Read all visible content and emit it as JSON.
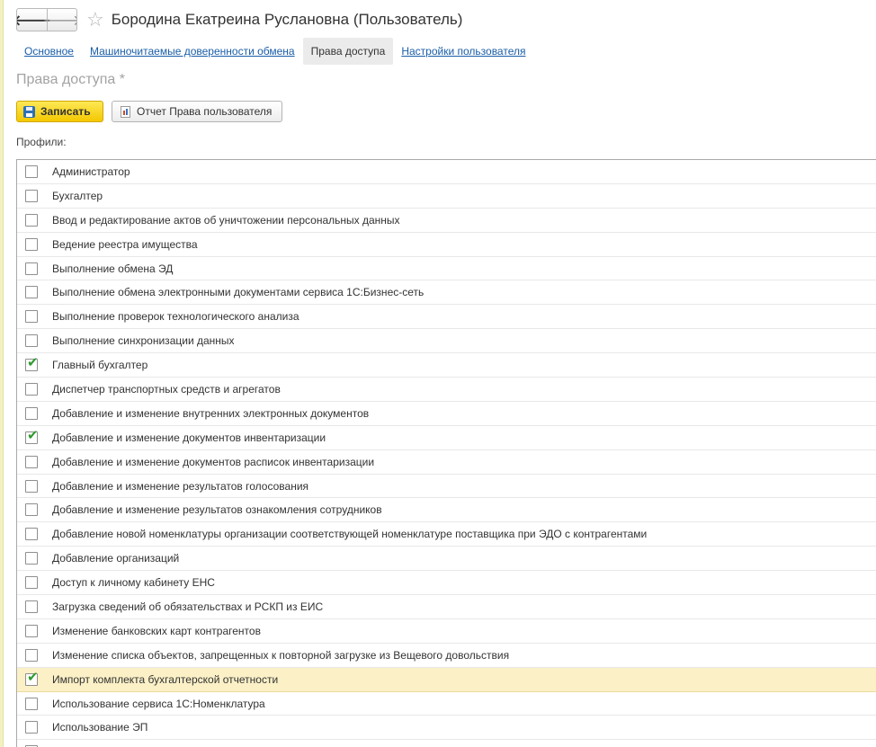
{
  "window": {
    "title": "Бородина Екатреина Руслановна (Пользователь)",
    "back_icon": "arrow-left-icon",
    "forward_icon": "arrow-right-icon",
    "favorite_icon": "star-icon"
  },
  "tabs": [
    {
      "label": "Основное",
      "active": false
    },
    {
      "label": "Машиночитаемые доверенности обмена",
      "active": false
    },
    {
      "label": "Права доступа",
      "active": true
    },
    {
      "label": "Настройки пользователя",
      "active": false
    }
  ],
  "section_title": "Права доступа *",
  "toolbar": {
    "save_label": "Записать",
    "report_label": "Отчет Права пользователя"
  },
  "profiles_label": "Профили:",
  "colors": {
    "accent": "#f4c800",
    "link": "#1a5ea8",
    "selected_row": "#fbf0c6",
    "check": "#2f9a2f"
  },
  "profiles": [
    {
      "label": "Администратор",
      "checked": false
    },
    {
      "label": "Бухгалтер",
      "checked": false
    },
    {
      "label": "Ввод и редактирование актов об уничтожении персональных данных",
      "checked": false
    },
    {
      "label": "Ведение реестра имущества",
      "checked": false
    },
    {
      "label": "Выполнение обмена ЭД",
      "checked": false
    },
    {
      "label": "Выполнение обмена электронными документами сервиса 1С:Бизнес-сеть",
      "checked": false
    },
    {
      "label": "Выполнение проверок технологического анализа",
      "checked": false
    },
    {
      "label": "Выполнение синхронизации данных",
      "checked": false
    },
    {
      "label": "Главный бухгалтер",
      "checked": true
    },
    {
      "label": "Диспетчер транспортных средств и агрегатов",
      "checked": false
    },
    {
      "label": "Добавление и изменение внутренних электронных документов",
      "checked": false
    },
    {
      "label": "Добавление и изменение документов инвентаризации",
      "checked": true
    },
    {
      "label": "Добавление и изменение документов расписок инвентаризации",
      "checked": false
    },
    {
      "label": "Добавление и изменение результатов голосования",
      "checked": false
    },
    {
      "label": "Добавление и изменение результатов ознакомления сотрудников",
      "checked": false
    },
    {
      "label": "Добавление новой номенклатуры организации соответствующей номенклатуре поставщика при ЭДО с контрагентами",
      "checked": false
    },
    {
      "label": "Добавление организаций",
      "checked": false
    },
    {
      "label": "Доступ к личному кабинету ЕНС",
      "checked": false
    },
    {
      "label": "Загрузка сведений об обязательствах и РСКП из ЕИС",
      "checked": false
    },
    {
      "label": "Изменение банковских карт контрагентов",
      "checked": false
    },
    {
      "label": "Изменение списка объектов, запрещенных к повторной загрузке из Вещевого довольствия",
      "checked": false
    },
    {
      "label": "Импорт комплекта бухгалтерской отчетности",
      "checked": true,
      "selected": true
    },
    {
      "label": "Использование сервиса 1С:Номенклатура",
      "checked": false
    },
    {
      "label": "Использование ЭП",
      "checked": false
    },
    {
      "label": "",
      "checked": false
    }
  ]
}
